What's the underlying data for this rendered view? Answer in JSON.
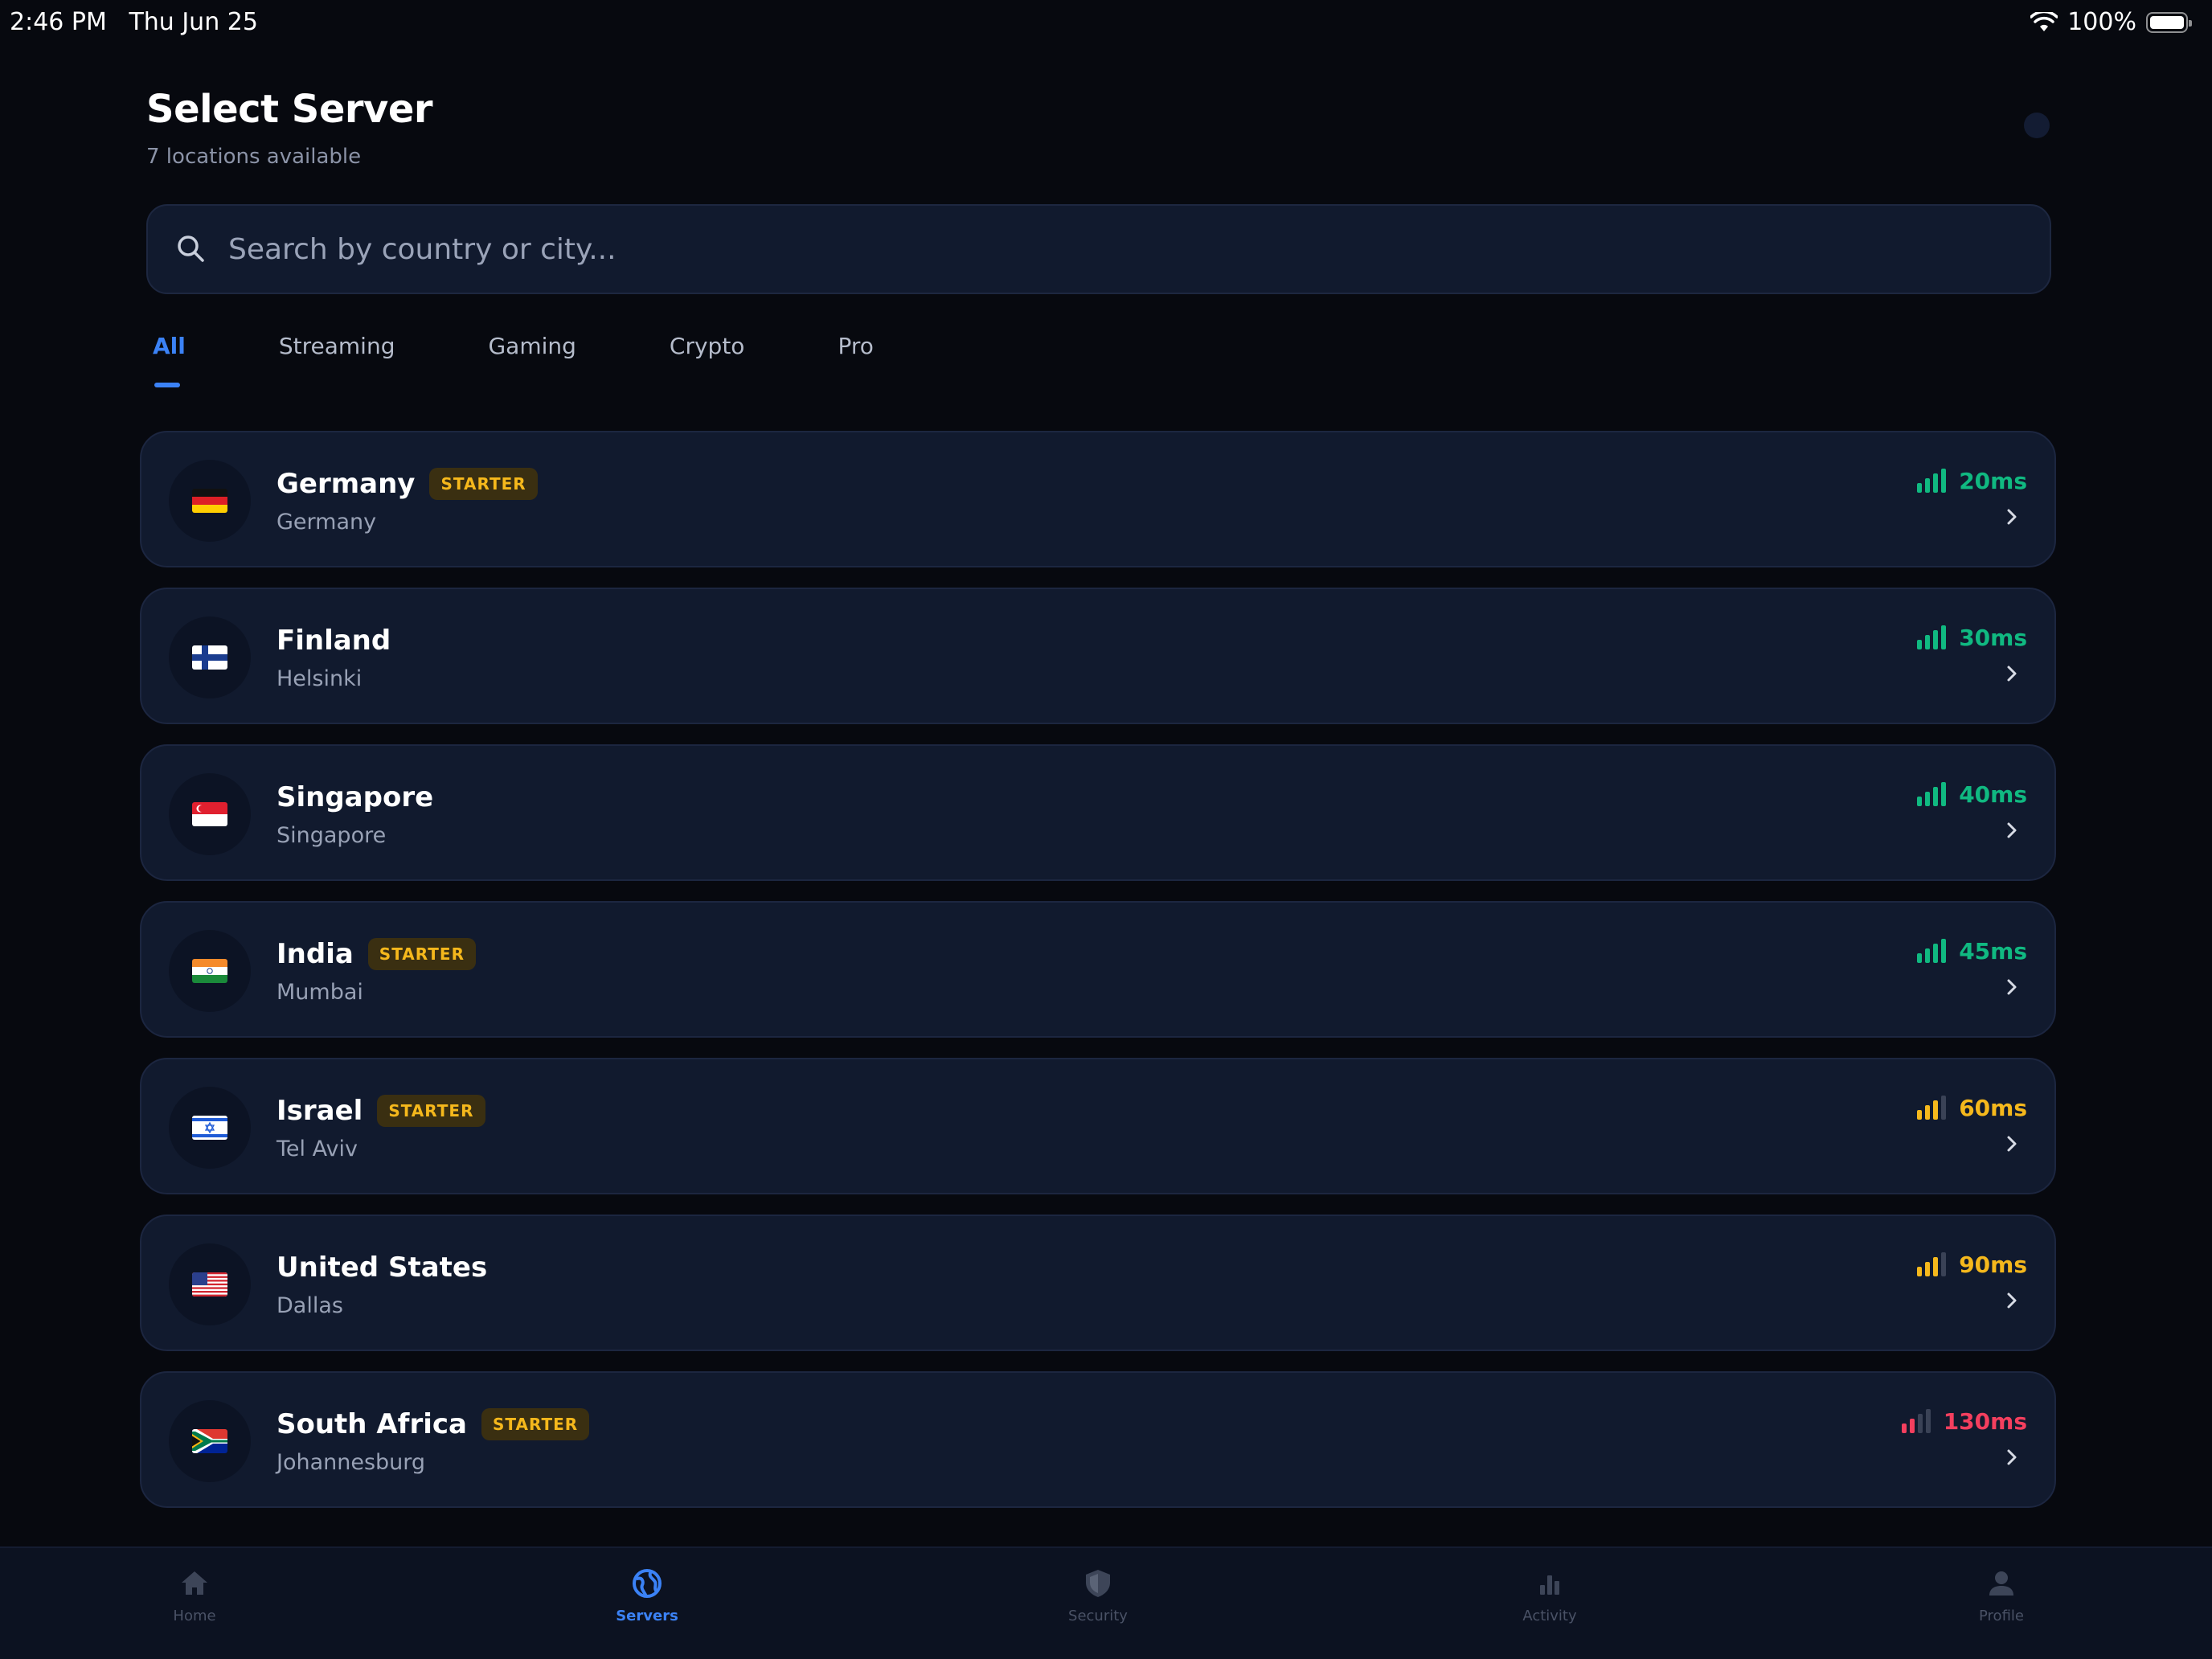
{
  "status_bar": {
    "time": "2:46 PM",
    "date": "Thu Jun 25",
    "battery": "100%"
  },
  "header": {
    "title": "Select Server",
    "subtitle": "7 locations available"
  },
  "search": {
    "placeholder": "Search by country or city...",
    "value": ""
  },
  "tabs": [
    {
      "label": "All",
      "active": true
    },
    {
      "label": "Streaming",
      "active": false
    },
    {
      "label": "Gaming",
      "active": false
    },
    {
      "label": "Crypto",
      "active": false
    },
    {
      "label": "Pro",
      "active": false
    }
  ],
  "servers": [
    {
      "name": "Germany",
      "city": "Germany",
      "badge": "STARTER",
      "ping": "20ms",
      "flag": "germany-flag",
      "signal_level": 4,
      "signal_color": "#10b981"
    },
    {
      "name": "Finland",
      "city": "Helsinki",
      "badge": "",
      "ping": "30ms",
      "flag": "finland-flag",
      "signal_level": 4,
      "signal_color": "#10b981"
    },
    {
      "name": "Singapore",
      "city": "Singapore",
      "badge": "",
      "ping": "40ms",
      "flag": "singapore-flag",
      "signal_level": 4,
      "signal_color": "#10b981"
    },
    {
      "name": "India",
      "city": "Mumbai",
      "badge": "STARTER",
      "ping": "45ms",
      "flag": "india-flag",
      "signal_level": 4,
      "signal_color": "#10b981"
    },
    {
      "name": "Israel",
      "city": "Tel Aviv",
      "badge": "STARTER",
      "ping": "60ms",
      "flag": "israel-flag",
      "signal_level": 3,
      "signal_color": "#f5b81c"
    },
    {
      "name": "United States",
      "city": "Dallas",
      "badge": "",
      "ping": "90ms",
      "flag": "usa-flag",
      "signal_level": 3,
      "signal_color": "#f5b81c"
    },
    {
      "name": "South Africa",
      "city": "Johannesburg",
      "badge": "STARTER",
      "ping": "130ms",
      "flag": "south-africa-flag",
      "signal_level": 2,
      "signal_color": "#f43f5e"
    }
  ],
  "bottom_nav": [
    {
      "label": "Home",
      "icon": "home-icon",
      "active": false
    },
    {
      "label": "Servers",
      "icon": "globe-icon",
      "active": true
    },
    {
      "label": "Security",
      "icon": "shield-icon",
      "active": false
    },
    {
      "label": "Activity",
      "icon": "bar-chart-icon",
      "active": false
    },
    {
      "label": "Profile",
      "icon": "person-icon",
      "active": false
    }
  ],
  "colors": {
    "accent": "#3b82f6",
    "background": "#07090f",
    "card": "#111a2e",
    "badge_text": "#f5b81c",
    "good": "#10b981",
    "fair": "#f5b81c",
    "poor": "#f43f5e"
  }
}
